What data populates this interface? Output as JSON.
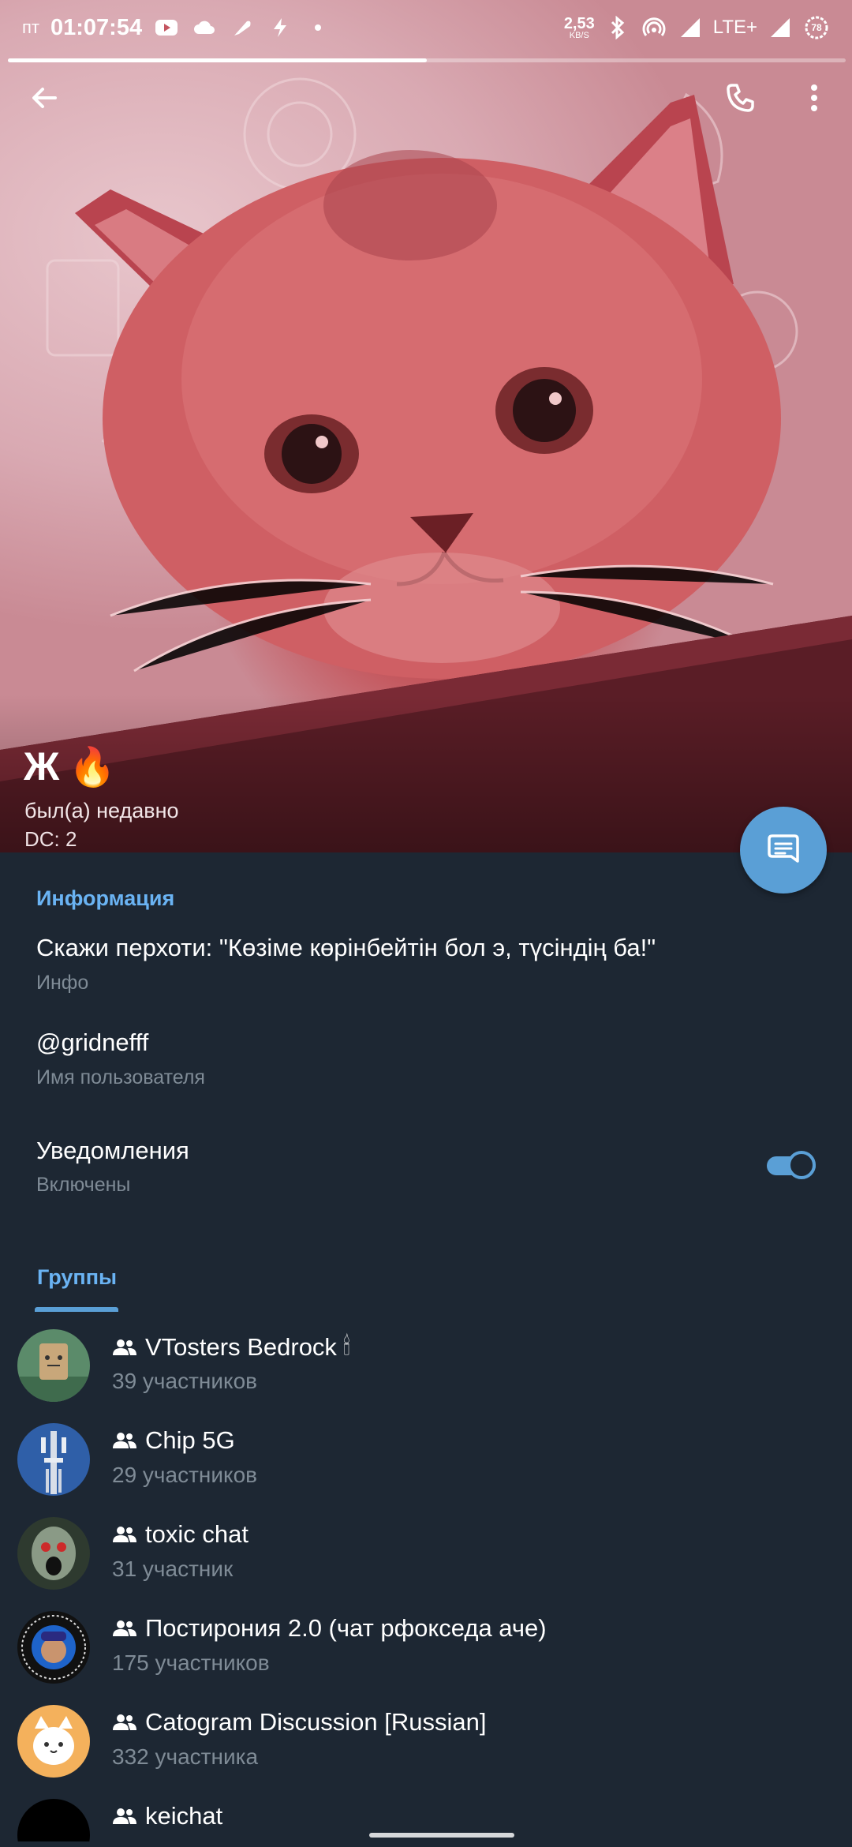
{
  "statusbar": {
    "day": "пт",
    "time": "01:07:54",
    "net_speed": "2,53",
    "net_unit": "KB/S",
    "network": "LTE+",
    "battery": "78"
  },
  "profile": {
    "name": "Ж",
    "emoji": "🔥",
    "status": "был(а) недавно",
    "dc": "DC: 2"
  },
  "info": {
    "section_title": "Информация",
    "bio": "Скажи перхоти: \"Көзіме көрінбейтін бол э, түсіндің ба!\"",
    "bio_label": "Инфо",
    "username": "@gridnefff",
    "username_label": "Имя пользователя",
    "notifications": "Уведомления",
    "notifications_state": "Включены",
    "notifications_on": true
  },
  "groups": {
    "section_title": "Группы",
    "items": [
      {
        "name": "VTosters Bedrock",
        "suffix": "🕯",
        "members": "39 участников"
      },
      {
        "name": "Chip 5G",
        "suffix": "",
        "members": "29 участников"
      },
      {
        "name": "toxic chat",
        "suffix": "",
        "members": "31 участник"
      },
      {
        "name": "Постирония 2.0 (чат рфокседа аче)",
        "suffix": "",
        "members": "175 участников"
      },
      {
        "name": "Catogram Discussion [Russian]",
        "suffix": "",
        "members": "332 участника"
      },
      {
        "name": "keichat",
        "suffix": "",
        "members": ""
      }
    ]
  },
  "colors": {
    "background": "#1d2733",
    "accent": "#6ab3f3",
    "fab": "#5a9fd6",
    "secondary_text": "#7f8b96"
  },
  "story_progress": 0.5
}
